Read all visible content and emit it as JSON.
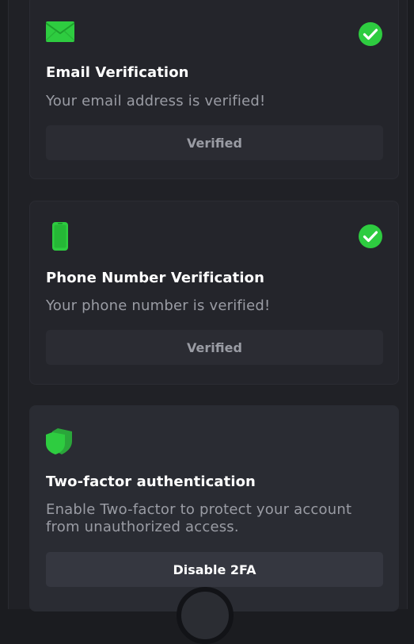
{
  "email_card": {
    "icon": "envelope-icon",
    "status_icon": "check-circle-icon",
    "title": "Email Verification",
    "description": "Your email address is verified!",
    "button_label": "Verified"
  },
  "phone_card": {
    "icon": "phone-icon",
    "status_icon": "check-circle-icon",
    "title": "Phone Number Verification",
    "description": "Your phone number is verified!",
    "button_label": "Verified"
  },
  "twofa_card": {
    "icon": "shield-icon",
    "title": "Two-factor authentication",
    "description": "Enable Two-factor to protect your account from unauthorized access.",
    "button_label": "Disable 2FA"
  },
  "colors": {
    "accent_green": "#22c55e",
    "background": "#1b1c20"
  }
}
